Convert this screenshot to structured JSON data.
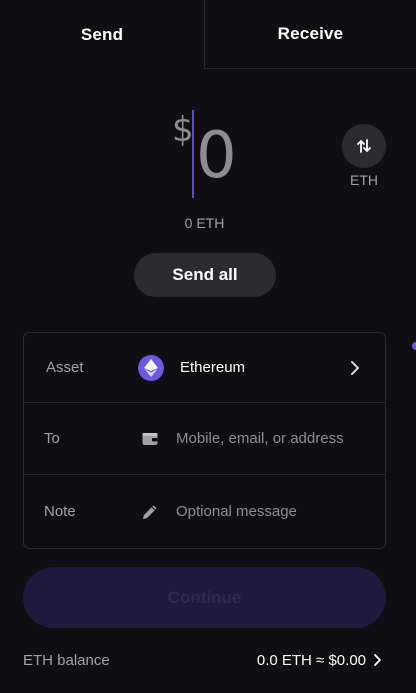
{
  "tabs": {
    "send": "Send",
    "receive": "Receive"
  },
  "amount": {
    "currency_symbol": "$",
    "value": "0",
    "converted": "0 ETH",
    "swap_label": "ETH"
  },
  "send_all_label": "Send all",
  "form": {
    "asset": {
      "label": "Asset",
      "value": "Ethereum"
    },
    "to": {
      "label": "To",
      "placeholder": "Mobile, email, or address"
    },
    "note": {
      "label": "Note",
      "placeholder": "Optional message"
    }
  },
  "continue_label": "Continue",
  "balance": {
    "label": "ETH balance",
    "value": "0.0 ETH ≈ $0.00"
  },
  "colors": {
    "background": "#0f0e10",
    "accent": "#6f56e3",
    "button_dark": "#2c2b30",
    "continue_disabled": "#1f1a3d"
  },
  "icons": {
    "swap": "swap-arrows-icon",
    "asset": "ethereum-icon",
    "to": "wallet-icon",
    "note": "pencil-icon",
    "chevron": "chevron-right-icon"
  }
}
